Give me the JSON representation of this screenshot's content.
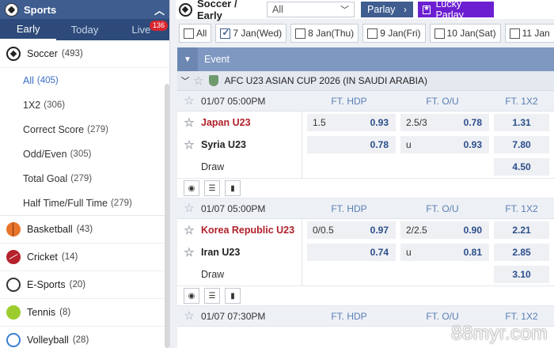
{
  "sidebar": {
    "title": "Sports",
    "tabs": [
      {
        "label": "Early"
      },
      {
        "label": "Today"
      },
      {
        "label": "Live",
        "badge": "136"
      }
    ],
    "soccer": {
      "label": "Soccer",
      "count": "(493)"
    },
    "soccer_sub": [
      {
        "label": "All",
        "count": "(405)"
      },
      {
        "label": "1X2",
        "count": "(306)"
      },
      {
        "label": "Correct Score",
        "count": "(279)"
      },
      {
        "label": "Odd/Even",
        "count": "(305)"
      },
      {
        "label": "Total Goal",
        "count": "(279)"
      },
      {
        "label": "Half Time/Full Time",
        "count": "(279)"
      }
    ],
    "sports": [
      {
        "label": "Basketball",
        "count": "(43)",
        "icon": "basketball-icon"
      },
      {
        "label": "Cricket",
        "count": "(14)",
        "icon": "cricket-icon"
      },
      {
        "label": "E-Sports",
        "count": "(20)",
        "icon": "headset-icon"
      },
      {
        "label": "Tennis",
        "count": "(8)",
        "icon": "tennis-ball-icon"
      },
      {
        "label": "Volleyball",
        "count": "(28)",
        "icon": "volleyball-icon"
      }
    ]
  },
  "topbar": {
    "title": "Soccer / Early",
    "market_select": "All",
    "parlay_label": "Parlay",
    "lucky_label": "Lucky Parlay"
  },
  "dates": [
    {
      "label": "All",
      "checked": false
    },
    {
      "label": "7 Jan(Wed)",
      "checked": true
    },
    {
      "label": "8 Jan(Thu)",
      "checked": false
    },
    {
      "label": "9 Jan(Fri)",
      "checked": false
    },
    {
      "label": "10 Jan(Sat)",
      "checked": false
    },
    {
      "label": "11 Jan",
      "checked": false
    }
  ],
  "table": {
    "header": "Event",
    "league": "AFC U23 ASIAN CUP 2026 (IN SAUDI ARABIA)",
    "col_hdp": "FT. HDP",
    "col_ou": "FT. O/U",
    "col_1x2": "FT. 1X2",
    "matches": [
      {
        "time": "01/07 05:00PM",
        "home": "Japan U23",
        "away": "Syria U23",
        "draw": "Draw",
        "hdp_line": "1.5",
        "hdp_home": "0.93",
        "hdp_away": "0.78",
        "ou_line": "2.5/3",
        "ou_over": "0.78",
        "ou_under_label": "u",
        "ou_under": "0.93",
        "x1": "1.31",
        "x2": "7.80",
        "xd": "4.50"
      },
      {
        "time": "01/07 05:00PM",
        "home": "Korea Republic U23",
        "away": "Iran U23",
        "draw": "Draw",
        "hdp_line": "0/0.5",
        "hdp_home": "0.97",
        "hdp_away": "0.74",
        "ou_line": "2/2.5",
        "ou_over": "0.90",
        "ou_under_label": "u",
        "ou_under": "0.81",
        "x1": "2.21",
        "x2": "2.85",
        "xd": "3.10"
      },
      {
        "time": "01/07 07:30PM"
      }
    ]
  },
  "watermark": "88myr.com",
  "colors": {
    "nav": "#3f5d8f",
    "lucky": "#6c1fd1",
    "favorite": "#b0202a",
    "odds": "#2b4d8a"
  }
}
